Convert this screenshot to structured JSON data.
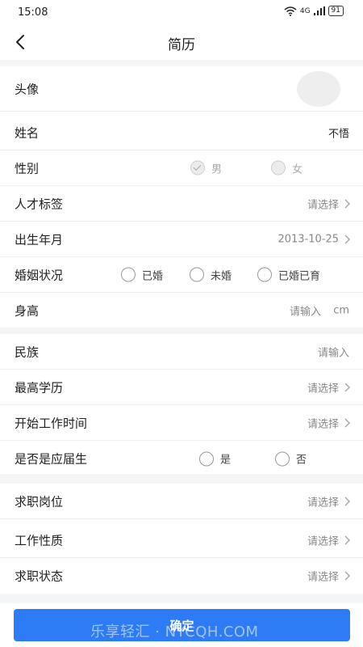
{
  "status_bar": {
    "time": "15:08",
    "network": "4G",
    "battery": "91"
  },
  "nav": {
    "title": "简历"
  },
  "rows": {
    "avatar": {
      "label": "头像"
    },
    "name": {
      "label": "姓名",
      "value": "不悟"
    },
    "gender": {
      "label": "性别",
      "options": [
        "男",
        "女"
      ],
      "selected": "男"
    },
    "talent_tag": {
      "label": "人才标签",
      "value": "请选择"
    },
    "birth": {
      "label": "出生年月",
      "value": "2013-10-25"
    },
    "marital": {
      "label": "婚姻状况",
      "options": [
        "已婚",
        "未婚",
        "已婚已育"
      ]
    },
    "height": {
      "label": "身高",
      "placeholder": "请输入",
      "unit": "cm"
    },
    "ethnicity": {
      "label": "民族",
      "placeholder": "请输入"
    },
    "education": {
      "label": "最高学历",
      "value": "请选择"
    },
    "work_start": {
      "label": "开始工作时间",
      "value": "请选择"
    },
    "graduate": {
      "label": "是否是应届生",
      "options": [
        "是",
        "否"
      ]
    },
    "position": {
      "label": "求职岗位",
      "value": "请选择"
    },
    "job_type": {
      "label": "工作性质",
      "value": "请选择"
    },
    "job_status": {
      "label": "求职状态",
      "value": "请选择"
    }
  },
  "footer": {
    "confirm_label": "确定",
    "watermark": "乐享轻汇 · NYCQH.COM"
  },
  "colors": {
    "accent": "#2d7cf6",
    "section_gap": "#f4f5f7"
  }
}
